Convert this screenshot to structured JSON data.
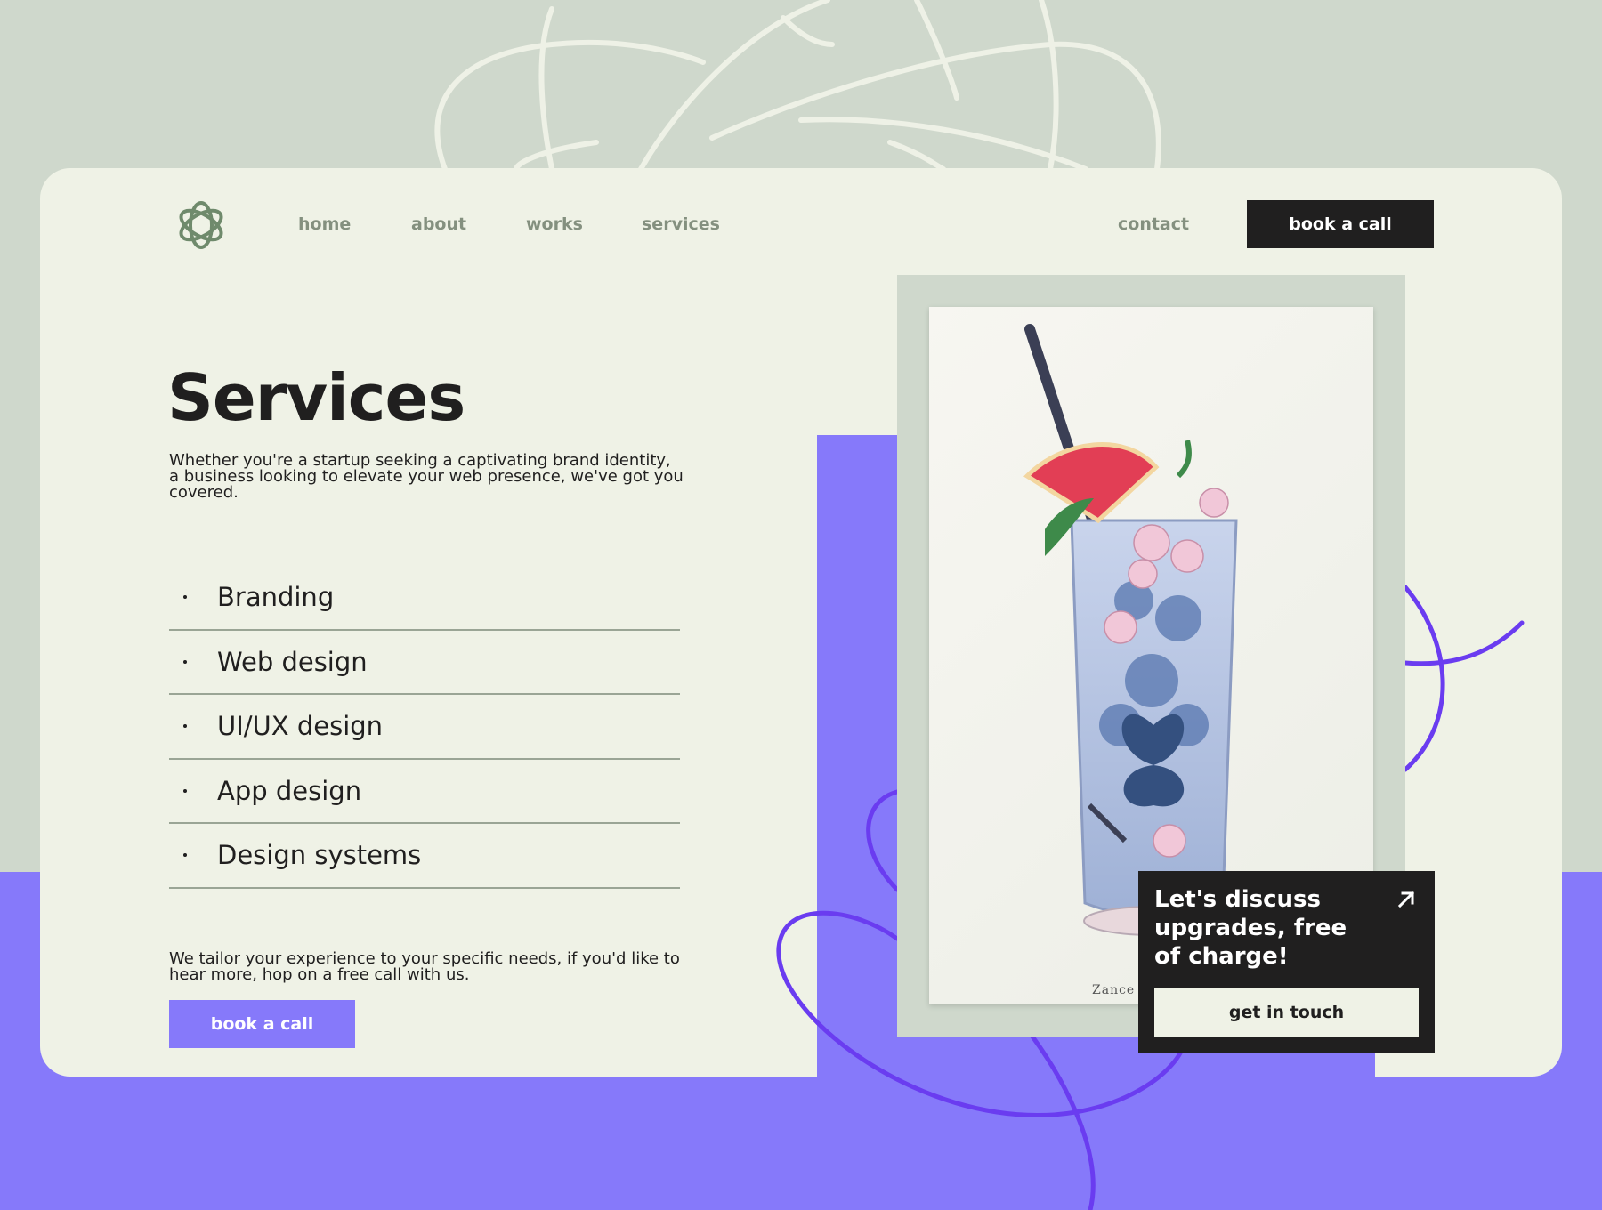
{
  "colors": {
    "background_sage": "#cfd8cc",
    "card": "#eff2e6",
    "accent_purple": "#8679fa",
    "swirl_purple": "#6a3cf0",
    "dark": "#201f1f",
    "nav_text": "#84907f"
  },
  "header": {
    "logo_icon": "knot-logo-icon",
    "nav": {
      "home": "home",
      "about": "about",
      "works": "works",
      "services": "services",
      "contact": "contact"
    },
    "cta_label": "book a call"
  },
  "main": {
    "title": "Services",
    "intro": "Whether you're a startup seeking a captivating brand identity, a business looking to elevate your web presence, we've got you covered.",
    "services": [
      "Branding",
      "Web design",
      "UI/UX design",
      "App design",
      "Design systems"
    ],
    "outro": "We tailor your experience to your specific needs, if you'd like to hear more, hop on a free call with us.",
    "cta_label": "book a call"
  },
  "artwork": {
    "signature": "Zance"
  },
  "promo": {
    "heading": "Let's discuss upgrades, free of charge!",
    "arrow_icon": "arrow-up-right-icon",
    "button_label": "get in touch"
  }
}
